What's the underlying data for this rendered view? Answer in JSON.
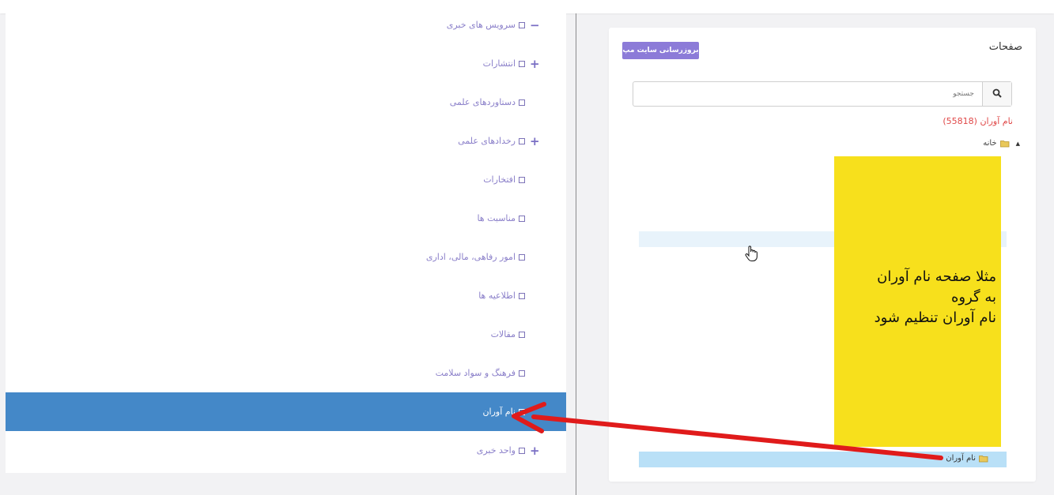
{
  "groups": [
    {
      "label": "سرویس های خبری",
      "toggle": "−",
      "checked": false
    },
    {
      "label": "انتشارات",
      "toggle": "+",
      "checked": false
    },
    {
      "label": "دستاوردهای علمی",
      "toggle": "",
      "checked": false
    },
    {
      "label": "رخدادهای علمی",
      "toggle": "+",
      "checked": false
    },
    {
      "label": "افتخارات",
      "toggle": "",
      "checked": false
    },
    {
      "label": "مناسبت ها",
      "toggle": "",
      "checked": false
    },
    {
      "label": "امور رفاهی، مالی، اداری",
      "toggle": "",
      "checked": false
    },
    {
      "label": "اطلاعیه ها",
      "toggle": "",
      "checked": false
    },
    {
      "label": "مقالات",
      "toggle": "",
      "checked": false
    },
    {
      "label": "فرهنگ و سواد سلامت",
      "toggle": "",
      "checked": false
    },
    {
      "label": "نام آوران",
      "toggle": "",
      "checked": true
    },
    {
      "label": "واحد خبری",
      "toggle": "+",
      "checked": false
    }
  ],
  "pages_panel": {
    "title": "صفحات",
    "update_sitemap_button": "بروزرسانی سایت مپ",
    "search_placeholder": "جستجو",
    "count_text": "نام آوران (55818)",
    "tree_root": "خانه",
    "tree_selected": "نام آوران"
  },
  "annotation": {
    "lines": [
      "مثلا صفحه نام آوران",
      "به گروه",
      "نام آوران تنظیم شود"
    ]
  },
  "colors": {
    "accent": "#8c7bd8",
    "selected_row": "#4488c8",
    "note_bg": "#f7e01c",
    "arrow": "#e01b1b",
    "count_text": "#e04848"
  },
  "icons": {
    "search": "magnifier",
    "folder": "folder-open",
    "cursor": "hand-pointer",
    "tree_expand": "triangle"
  }
}
